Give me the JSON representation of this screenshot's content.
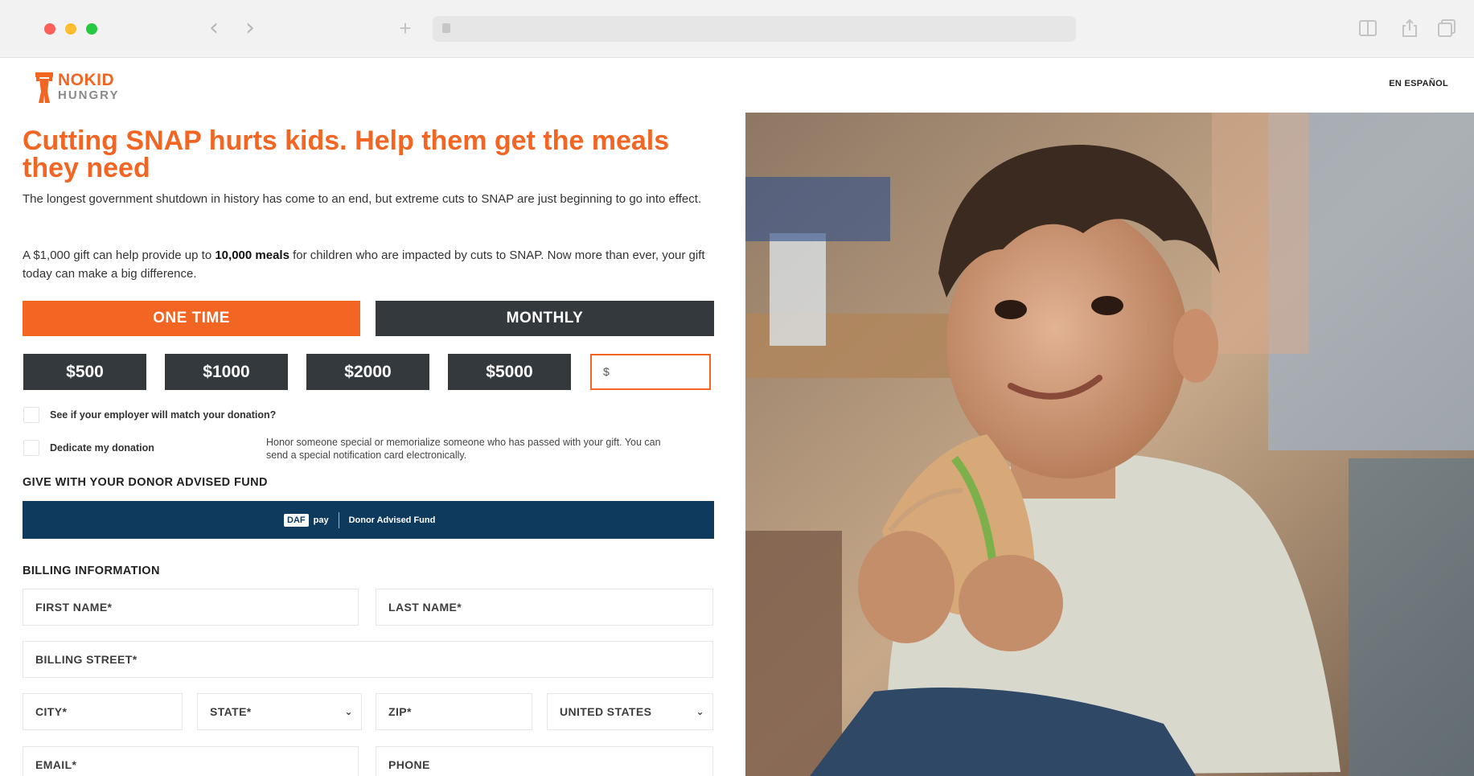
{
  "browser": {
    "back_icon": "chevron-left-icon",
    "forward_icon": "chevron-right-icon",
    "new_tab_icon": "plus-icon",
    "reader_icon": "reader-icon",
    "share_icon": "share-icon",
    "tabs_icon": "tabs-icon",
    "back_glyph": "‹",
    "forward_glyph": "›",
    "plus_glyph": "+"
  },
  "header": {
    "logo_line1_a": "NO",
    "logo_line1_b": "KID",
    "logo_line2": "HUNGRY",
    "language_link": "EN ESPAÑOL"
  },
  "hero": {
    "headline": "Cutting SNAP hurts kids. Help them get the meals they need",
    "paragraph1": "The longest government shutdown in history has come to an end, but extreme cuts to SNAP are just beginning to go into effect.",
    "paragraph2_pre": "A $1,000 gift can help provide up to ",
    "paragraph2_bold": "10,000 meals",
    "paragraph2_post": " for children who are impacted by cuts to SNAP. Now more than ever, your gift today can make a big difference."
  },
  "donation": {
    "frequency": {
      "one_time": "ONE TIME",
      "monthly": "MONTHLY",
      "selected": "ONE TIME"
    },
    "amounts": [
      "$500",
      "$1000",
      "$2000",
      "$5000"
    ],
    "other_amount_prefix": "$",
    "employer_match_label": "See if your employer will match your donation?",
    "dedicate_label": "Dedicate my donation",
    "dedicate_help": "Honor someone special or memorialize someone who has passed with your gift. You can send a special notification card electronically."
  },
  "daf": {
    "section_title": "GIVE WITH YOUR DONOR ADVISED FUND",
    "badge": "DAF",
    "pay": "pay",
    "text": "Donor Advised Fund"
  },
  "billing": {
    "section_title": "BILLING INFORMATION",
    "first_name": "FIRST NAME*",
    "last_name": "LAST NAME*",
    "street": "BILLING STREET*",
    "city": "CITY*",
    "state": "STATE*",
    "zip": "ZIP*",
    "country": "UNITED STATES",
    "email": "EMAIL*",
    "phone": "PHONE"
  },
  "colors": {
    "brand_orange": "#f26522",
    "dark_button": "#34393d",
    "daf_navy": "#0e3a5e"
  }
}
